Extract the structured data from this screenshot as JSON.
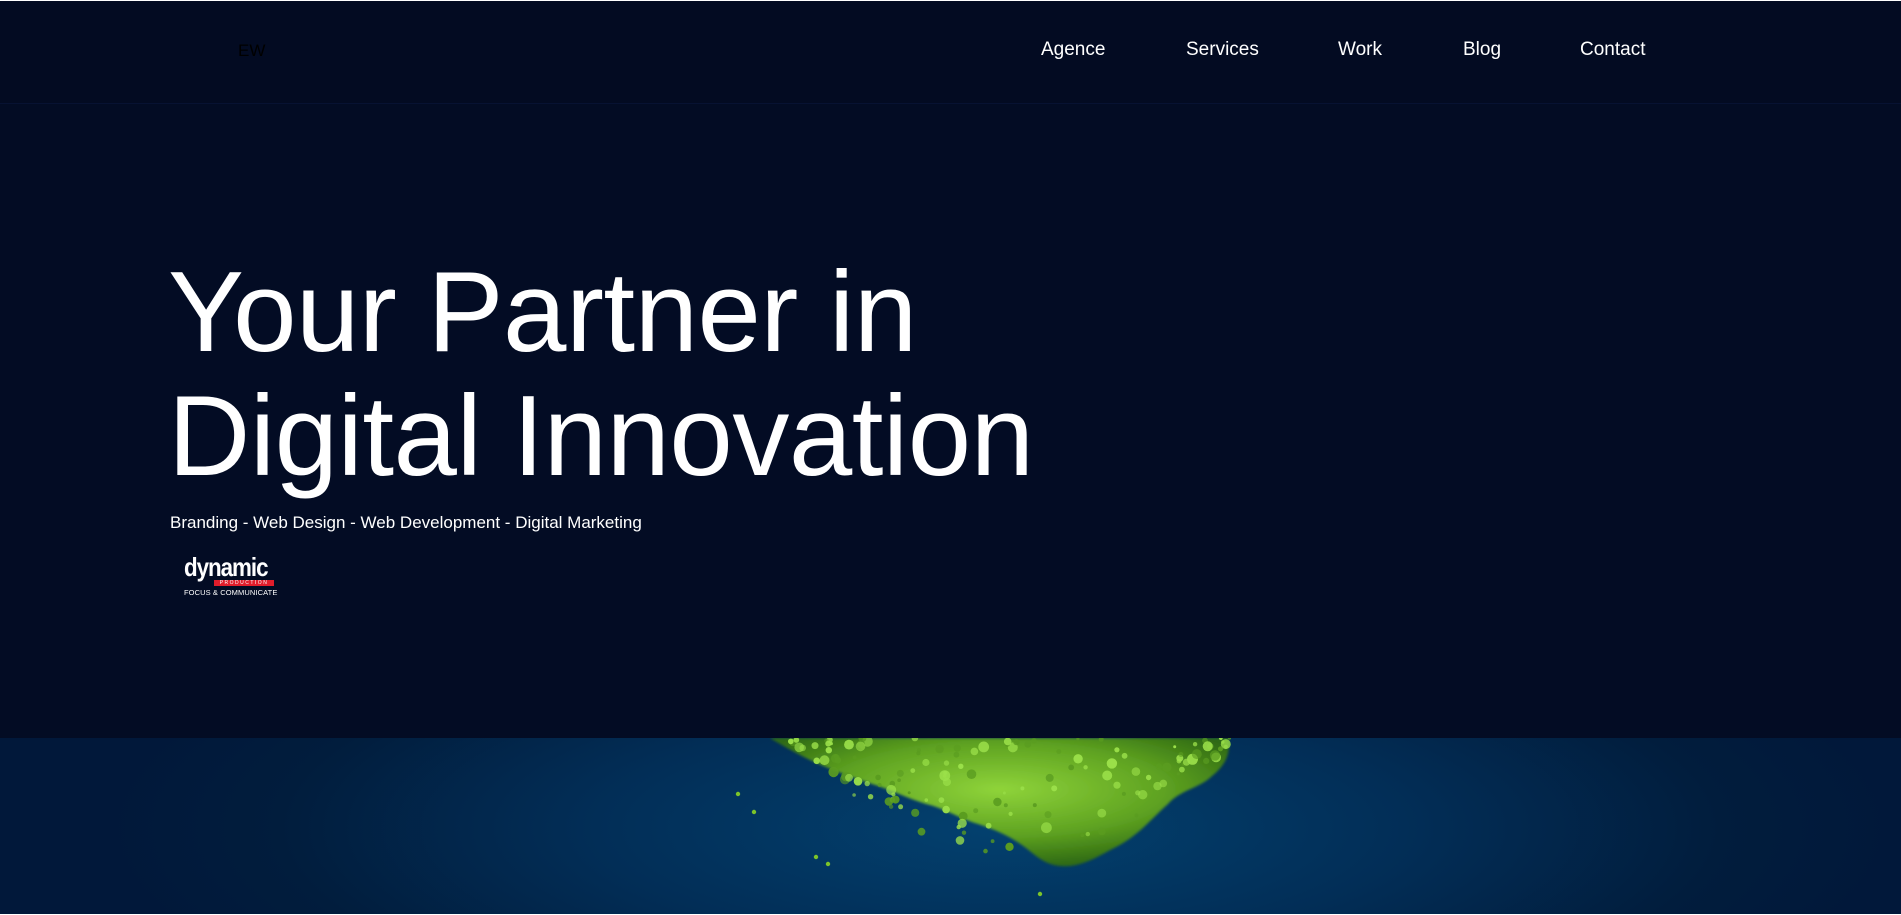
{
  "header": {
    "logo_text": "EW",
    "nav": [
      {
        "label": "Agence"
      },
      {
        "label": "Services"
      },
      {
        "label": "Work"
      },
      {
        "label": "Blog"
      },
      {
        "label": "Contact"
      }
    ]
  },
  "hero": {
    "title_line1": "Your Partner in",
    "title_line2": "Digital Innovation",
    "subtitle": "Branding - Web Design - Web Development - Digital Marketing",
    "partner_logo": {
      "name": "dynamic",
      "sub": "PRODUCTION",
      "tagline": "FOCUS & COMMUNICATE"
    }
  },
  "colors": {
    "background": "#030c24",
    "text": "#ffffff",
    "media_blue": "#022e57",
    "foliage_green": "#7cc42a",
    "brand_red": "#e11d2b"
  }
}
